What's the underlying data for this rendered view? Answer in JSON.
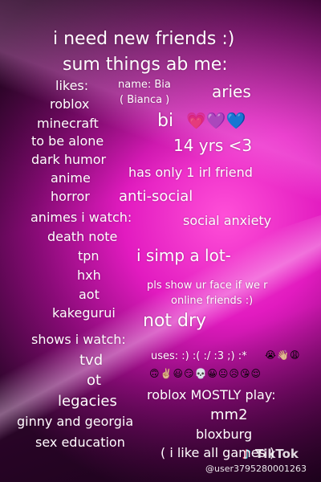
{
  "title_line1": "i need new friends :)",
  "title_line2": "sum things ab me:",
  "likes": {
    "header": "likes:",
    "items": [
      "roblox",
      "minecraft",
      "to be alone",
      "dark humor",
      "anime",
      "horror"
    ]
  },
  "name": "name: Bia",
  "name_alt": "( Bianca )",
  "sign": "aries",
  "orientation": "bi",
  "hearts": "💗💜💙",
  "age": "14 yrs <3",
  "irl_friends": "has only 1 irl friend",
  "anti_social": "anti-social",
  "social_anxiety": "social anxiety",
  "animes": {
    "header": "animes i watch:",
    "items": [
      "death note",
      "tpn",
      "hxh",
      "aot",
      "kakegurui"
    ]
  },
  "simp": "i simp a lot-",
  "show_face_line1": "pls show ur face if we r",
  "show_face_line2": "online friends :)",
  "not_dry": "not dry",
  "shows": {
    "header": "shows i watch:",
    "items": [
      "tvd",
      "ot",
      "legacies",
      "ginny and georgia",
      "sex education"
    ]
  },
  "uses_label": "uses: :) :( :/ :3 ;) :*",
  "uses_emojis_1": "😭👋🏼😩",
  "uses_emojis_2": "🙃✌🏼😃😏💀😀😐😥😘😌",
  "roblox_play": "roblox MOSTLY play:",
  "games": [
    "mm2",
    "bloxburg"
  ],
  "games_note": "( i like all games )",
  "watermark": "TikTok",
  "username": "@user3795280001263"
}
